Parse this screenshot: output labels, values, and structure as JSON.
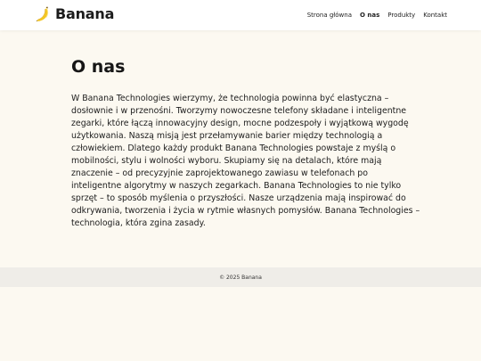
{
  "brand": {
    "name": "Banana",
    "icon": "banana-icon",
    "accent_color": "#f3c623"
  },
  "nav": {
    "items": [
      {
        "label": "Strona główna",
        "active": false
      },
      {
        "label": "O nas",
        "active": true
      },
      {
        "label": "Produkty",
        "active": false
      },
      {
        "label": "Kontakt",
        "active": false
      }
    ]
  },
  "page": {
    "title": "O nas",
    "body": "W Banana Technologies wierzymy, że technologia powinna być elastyczna – dosłownie i w przenośni. Tworzymy nowoczesne telefony składane i inteligentne zegarki, które łączą innowacyjny design, mocne podzespoły i wyjątkową wygodę użytkowania. Naszą misją jest przełamywanie barier między technologią a człowiekiem. Dlatego każdy produkt Banana Technologies powstaje z myślą o mobilności, stylu i wolności wyboru. Skupiamy się na detalach, które mają znaczenie – od precyzyjnie zaprojektowanego zawiasu w telefonach po inteligentne algorytmy w naszych zegarkach. Banana Technologies to nie tylko sprzęt – to sposób myślenia o przyszłości. Nasze urządzenia mają inspirować do odkrywania, tworzenia i życia w rytmie własnych pomysłów. Banana Technologies – technologia, która zgina zasady."
  },
  "footer": {
    "text": "© 2025 Banana"
  }
}
